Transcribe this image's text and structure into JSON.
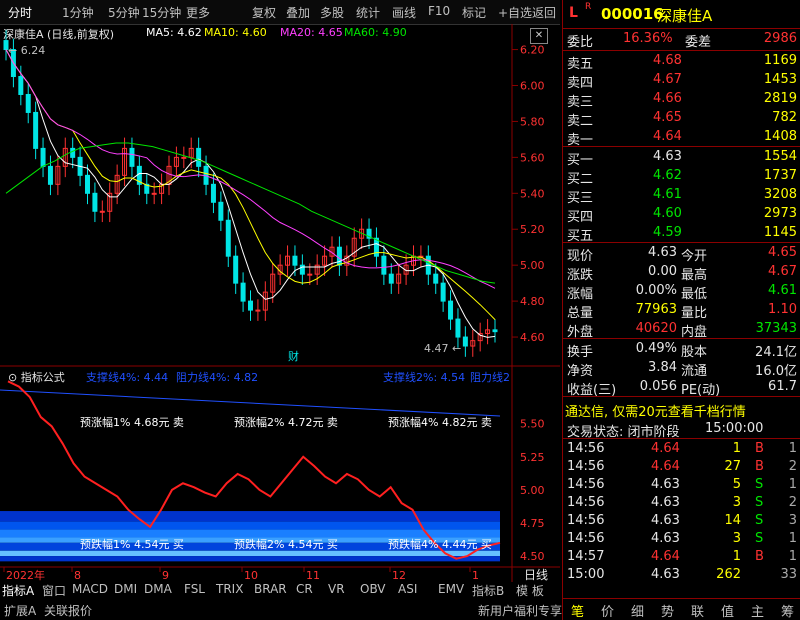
{
  "toolbar": {
    "items": [
      "分时",
      "1分钟",
      "5分钟",
      "15分钟",
      "更多",
      "复权",
      "叠加",
      "多股",
      "统计",
      "画线",
      "F10",
      "标记",
      "+自选",
      "返回"
    ]
  },
  "main": {
    "title": "深康佳A (日线,前复权)",
    "ma": [
      {
        "label": "MA5: 4.62",
        "color": "#ffffff"
      },
      {
        "label": "MA10: 4.60",
        "color": "#ffff00"
      },
      {
        "label": "MA20: 4.65",
        "color": "#ff40ff"
      },
      {
        "label": "MA60: 4.90",
        "color": "#00e600"
      }
    ],
    "max_label": "6.24",
    "min_label": "4.47",
    "fin_label": "财"
  },
  "indicator": {
    "title": "指标公式",
    "sup1": "支撑线4%: 4.44",
    "res1": "阻力线4%: 4.82",
    "sup2": "支撑线2%: 4.54",
    "res2": "阻力线2",
    "annotations_top": [
      "预涨幅1% 4.68元 卖",
      "预涨幅2% 4.72元 卖",
      "预涨幅4% 4.82元 卖"
    ],
    "annotations_bottom": [
      "预跌幅1% 4.54元 买",
      "预跌幅2% 4.54元 买",
      "预跌幅4% 4.44元 买"
    ]
  },
  "xaxis": {
    "labels": [
      "2022年",
      "8",
      "9",
      "10",
      "11",
      "12",
      "1"
    ],
    "period": "日线"
  },
  "bottom_tabs": [
    "指标A",
    "窗口",
    "MACD",
    "DMI",
    "DMA",
    "FSL",
    "TRIX",
    "BRAR",
    "CR",
    "VR",
    "OBV",
    "ASI",
    "EMV",
    "指标B",
    "模 板"
  ],
  "bottom_tabs2": [
    "扩展A",
    "关联报价",
    "新用户福利专享"
  ],
  "stock": {
    "code": "000016",
    "name": "深康佳A",
    "badge": "R",
    "market": "L"
  },
  "quote": {
    "weibi_label": "委比",
    "weibi": "16.36%",
    "weicha_label": "委差",
    "weicha": "2986",
    "asks": [
      {
        "label": "卖五",
        "price": "4.68",
        "vol": "1169"
      },
      {
        "label": "卖四",
        "price": "4.67",
        "vol": "1453"
      },
      {
        "label": "卖三",
        "price": "4.66",
        "vol": "2819"
      },
      {
        "label": "卖二",
        "price": "4.65",
        "vol": "782"
      },
      {
        "label": "卖一",
        "price": "4.64",
        "vol": "1408"
      }
    ],
    "bids": [
      {
        "label": "买一",
        "price": "4.63",
        "vol": "1554"
      },
      {
        "label": "买二",
        "price": "4.62",
        "vol": "1737"
      },
      {
        "label": "买三",
        "price": "4.61",
        "vol": "3208"
      },
      {
        "label": "买四",
        "price": "4.60",
        "vol": "2973"
      },
      {
        "label": "买五",
        "price": "4.59",
        "vol": "1145"
      }
    ],
    "stats": [
      [
        "现价",
        "4.63",
        "今开",
        "4.65"
      ],
      [
        "涨跌",
        "0.00",
        "最高",
        "4.67"
      ],
      [
        "涨幅",
        "0.00%",
        "最低",
        "4.61"
      ],
      [
        "总量",
        "77963",
        "量比",
        "1.10"
      ],
      [
        "外盘",
        "40620",
        "内盘",
        "37343"
      ]
    ],
    "stats2": [
      [
        "换手",
        "0.49%",
        "股本",
        "24.1亿"
      ],
      [
        "净资",
        "3.84",
        "流通",
        "16.0亿"
      ],
      [
        "收益(三)",
        "0.056",
        "PE(动)",
        "61.7"
      ]
    ],
    "promo": "通达信, 仅需20元查看千档行情",
    "status_label": "交易状态: 闭市阶段",
    "status_time": "15:00:00",
    "ticks": [
      [
        "14:56",
        "4.64",
        "1",
        "B",
        "1"
      ],
      [
        "14:56",
        "4.64",
        "27",
        "B",
        "2"
      ],
      [
        "14:56",
        "4.63",
        "5",
        "S",
        "1"
      ],
      [
        "14:56",
        "4.63",
        "3",
        "S",
        "2"
      ],
      [
        "14:56",
        "4.63",
        "14",
        "S",
        "3"
      ],
      [
        "14:56",
        "4.63",
        "3",
        "S",
        "1"
      ],
      [
        "14:57",
        "4.64",
        "1",
        "B",
        "1"
      ],
      [
        "15:00",
        "4.63",
        "262",
        "",
        "33"
      ]
    ]
  },
  "side_tabs": [
    "笔",
    "价",
    "细",
    "势",
    "联",
    "值",
    "主",
    "筹"
  ],
  "chart_data": {
    "type": "candlestick",
    "yaxis_main": {
      "ticks": [
        6.2,
        6.0,
        5.8,
        5.6,
        5.4,
        5.2,
        5.0,
        4.8,
        4.6
      ],
      "range": [
        4.45,
        6.32
      ]
    },
    "yaxis_ind": {
      "ticks": [
        5.5,
        5.25,
        5.0,
        4.75,
        4.5
      ],
      "range": [
        4.44,
        5.83
      ]
    },
    "close": [
      6.2,
      6.05,
      5.95,
      5.85,
      5.65,
      5.55,
      5.45,
      5.55,
      5.65,
      5.6,
      5.5,
      5.4,
      5.3,
      5.3,
      5.4,
      5.5,
      5.65,
      5.55,
      5.45,
      5.4,
      5.4,
      5.45,
      5.55,
      5.6,
      5.6,
      5.65,
      5.55,
      5.45,
      5.35,
      5.25,
      5.05,
      4.9,
      4.8,
      4.75,
      4.75,
      4.85,
      4.95,
      5.0,
      5.05,
      5.0,
      4.95,
      4.95,
      5.0,
      5.05,
      5.1,
      5.0,
      5.05,
      5.15,
      5.2,
      5.15,
      5.05,
      4.95,
      4.9,
      4.95,
      5.0,
      5.05,
      5.05,
      4.95,
      4.9,
      4.8,
      4.7,
      4.6,
      4.55,
      4.58,
      4.62,
      4.64,
      4.63
    ],
    "ma60": [
      5.4,
      5.45,
      5.5,
      5.55,
      5.58,
      5.62,
      5.65,
      5.66,
      5.67,
      5.68,
      5.68,
      5.67,
      5.66,
      5.64,
      5.62,
      5.6,
      5.58,
      5.55,
      5.52,
      5.49,
      5.46,
      5.43,
      5.4,
      5.37,
      5.34,
      5.3,
      5.27,
      5.24,
      5.21,
      5.18,
      5.15,
      5.12,
      5.09,
      5.06,
      5.03,
      5.0,
      4.97,
      4.95,
      4.93,
      4.91,
      4.9
    ],
    "indicator_line": [
      5.82,
      5.78,
      5.7,
      5.55,
      5.48,
      5.35,
      5.2,
      5.1,
      5.05,
      5.0,
      4.95,
      4.85,
      4.78,
      4.72,
      4.85,
      5.0,
      5.05,
      5.02,
      4.98,
      4.95,
      5.05,
      5.12,
      5.08,
      5.0,
      4.95,
      5.05,
      5.15,
      5.25,
      5.18,
      5.1,
      5.05,
      5.12,
      5.08,
      5.0,
      4.95,
      5.02,
      4.9,
      4.85,
      4.7,
      4.6,
      4.52,
      4.48,
      4.5,
      4.55,
      4.58,
      4.6
    ]
  }
}
